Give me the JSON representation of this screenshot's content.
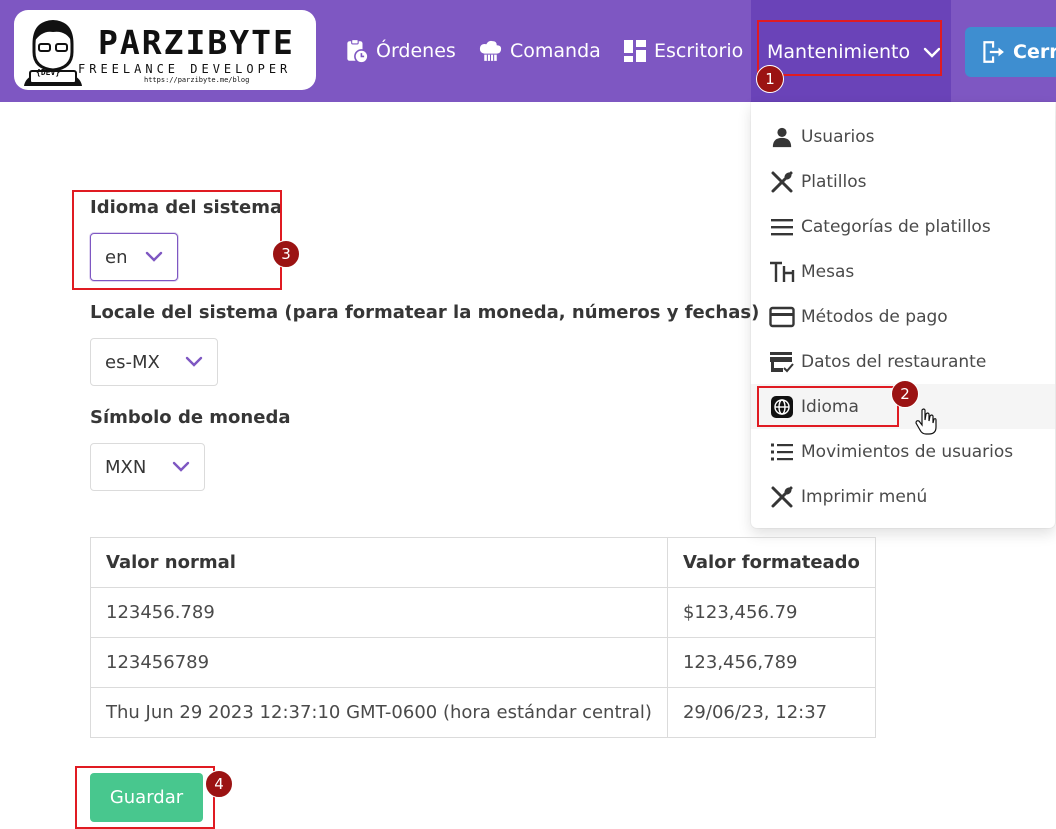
{
  "navbar": {
    "logo": {
      "brand": "PARZIBYTE",
      "tagline": "FREELANCE DEVELOPER",
      "url": "https://parzibyte.me/blog",
      "badge": "{DEV}"
    },
    "items": [
      {
        "label": "Órdenes",
        "icon": "clipboard-clock-icon"
      },
      {
        "label": "Comanda",
        "icon": "chef-hat-icon"
      },
      {
        "label": "Escritorio",
        "icon": "dashboard-icon"
      }
    ],
    "maintenance_label": "Mantenimiento",
    "logout_label": "Cerra"
  },
  "dropdown": {
    "items": [
      {
        "label": "Usuarios",
        "icon": "user-icon"
      },
      {
        "label": "Platillos",
        "icon": "utensils-icon"
      },
      {
        "label": "Categorías de platillos",
        "icon": "lines-icon"
      },
      {
        "label": "Mesas",
        "icon": "table-chairs-icon"
      },
      {
        "label": "Métodos de pago",
        "icon": "credit-card-icon"
      },
      {
        "label": "Datos del restaurante",
        "icon": "store-check-icon"
      },
      {
        "label": "Idioma",
        "icon": "globe-icon"
      },
      {
        "label": "Movimientos de usuarios",
        "icon": "list-icon"
      },
      {
        "label": "Imprimir menú",
        "icon": "utensils-icon"
      }
    ]
  },
  "form": {
    "language_label": "Idioma del sistema",
    "language_value": "en",
    "locale_label": "Locale del sistema (para formatear la moneda, números y fechas)",
    "locale_value": "es-MX",
    "currency_label": "Símbolo de moneda",
    "currency_value": "MXN"
  },
  "table": {
    "headers": [
      "Valor normal",
      "Valor formateado"
    ],
    "rows": [
      [
        "123456.789",
        "$123,456.79"
      ],
      [
        "123456789",
        "123,456,789"
      ],
      [
        "Thu Jun 29 2023 12:37:10 GMT-0600 (hora estándar central)",
        "29/06/23, 12:37"
      ]
    ]
  },
  "save_label": "Guardar",
  "annotations": [
    "1",
    "2",
    "3",
    "4"
  ],
  "colors": {
    "navbar": "#7e57c2",
    "navbar_active": "#6a43b8",
    "save": "#48c78e",
    "logout": "#3e8ed0",
    "highlight": "#e01b22",
    "badge": "#9b1313"
  }
}
